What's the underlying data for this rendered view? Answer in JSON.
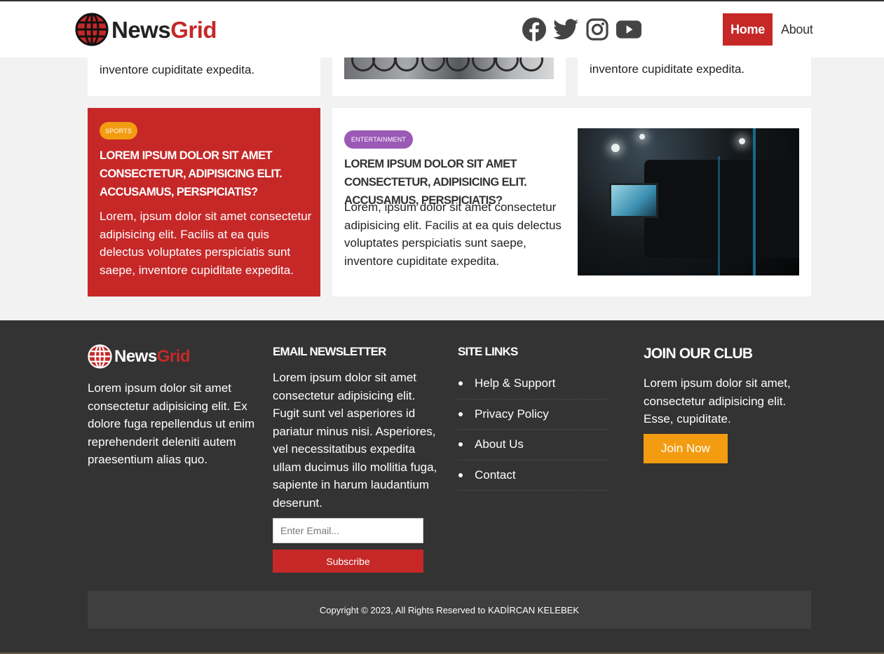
{
  "brand": {
    "name_part1": "News",
    "name_part2": "Grid"
  },
  "colors": {
    "accent_red": "#c62828",
    "orange": "#f39c12",
    "purple": "#9b59b6",
    "footer_bg": "#333333"
  },
  "header": {
    "social_icons": [
      "facebook-icon",
      "twitter-icon",
      "instagram-icon",
      "youtube-icon"
    ],
    "nav": {
      "home": "Home",
      "about": "About"
    }
  },
  "cards": {
    "top_left_text": "inventore cupiditate expedita.",
    "top_right_text": "inventore cupiditate expedita.",
    "sports": {
      "tag": "SPORTS",
      "headline": "Lorem ipsum dolor sit amet consectetur, adipisicing elit. Accusamus, perspiciatis?",
      "body": "Lorem, ipsum dolor sit amet consectetur adipisicing elit. Facilis at ea quis delectus voluptates perspiciatis sunt saepe, inventore cupiditate expedita."
    },
    "entertainment": {
      "tag": "ENTERTAINMENT",
      "headline": "Lorem ipsum dolor sit amet consectetur, adipisicing elit. Accusamus, perspiciatis?",
      "body": "Lorem, ipsum dolor sit amet consectetur adipisicing elit. Facilis at ea quis delectus voluptates perspiciatis sunt saepe, inventore cupiditate expedita."
    }
  },
  "footer": {
    "about_text": "Lorem ipsum dolor sit amet consectetur adipisicing elit. Ex dolore fuga repellendus ut enim reprehenderit deleniti autem praesentium alias quo.",
    "newsletter": {
      "heading": "Email Newsletter",
      "text": "Lorem ipsum dolor sit amet consectetur adipisicing elit. Fugit sunt vel asperiores id pariatur minus nisi. Asperiores, vel necessitatibus expedita ullam ducimus illo mollitia fuga, sapiente in harum laudantium deserunt.",
      "email_placeholder": "Enter Email...",
      "subscribe": "Subscribe"
    },
    "site_links": {
      "heading": "Site Links",
      "items": [
        "Help & Support",
        "Privacy Policy",
        "About Us",
        "Contact"
      ]
    },
    "club": {
      "heading": "Join Our Club",
      "text": "Lorem ipsum dolor sit amet, consectetur adipisicing elit. Esse, cupiditate.",
      "button": "Join Now"
    },
    "copyright": "Copyright © 2023, All Rights Reserved to KADİRCAN KELEBEK"
  }
}
